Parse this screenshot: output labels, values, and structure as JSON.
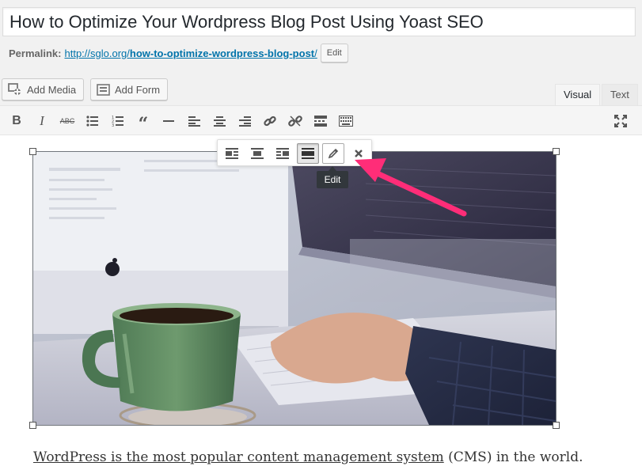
{
  "post": {
    "title": "How to Optimize Your Wordpress Blog Post Using Yoast SEO"
  },
  "permalink": {
    "label": "Permalink:",
    "url_base": "http://sglo.org/",
    "url_slug": "how-to-optimize-wordpress-blog-post",
    "url_end": "/",
    "edit_label": "Edit"
  },
  "media_buttons": {
    "add_media": "Add Media",
    "add_form": "Add Form"
  },
  "editor_tabs": {
    "visual": "Visual",
    "text": "Text"
  },
  "toolbar_icons": [
    "bold-icon",
    "italic-icon",
    "strikethrough-icon",
    "bullet-list-icon",
    "numbered-list-icon",
    "blockquote-icon",
    "horizontal-line-icon",
    "align-left-icon",
    "align-center-icon",
    "align-right-icon",
    "insert-link-icon",
    "remove-link-icon",
    "read-more-icon",
    "toolbar-toggle-icon",
    "fullscreen-icon"
  ],
  "image_toolbar": {
    "icons": [
      "align-left-icon",
      "align-center-icon",
      "align-right-icon",
      "align-none-icon",
      "edit-pencil-icon",
      "remove-x-icon"
    ],
    "tooltip": "Edit"
  },
  "content": {
    "paragraph_link_text": "WordPress is the most popular content management system",
    "paragraph_rest": " (CMS) in the world."
  },
  "colors": {
    "link": "#0073aa",
    "annotation_arrow": "#ff2d78",
    "tooltip_bg": "#32373c"
  }
}
